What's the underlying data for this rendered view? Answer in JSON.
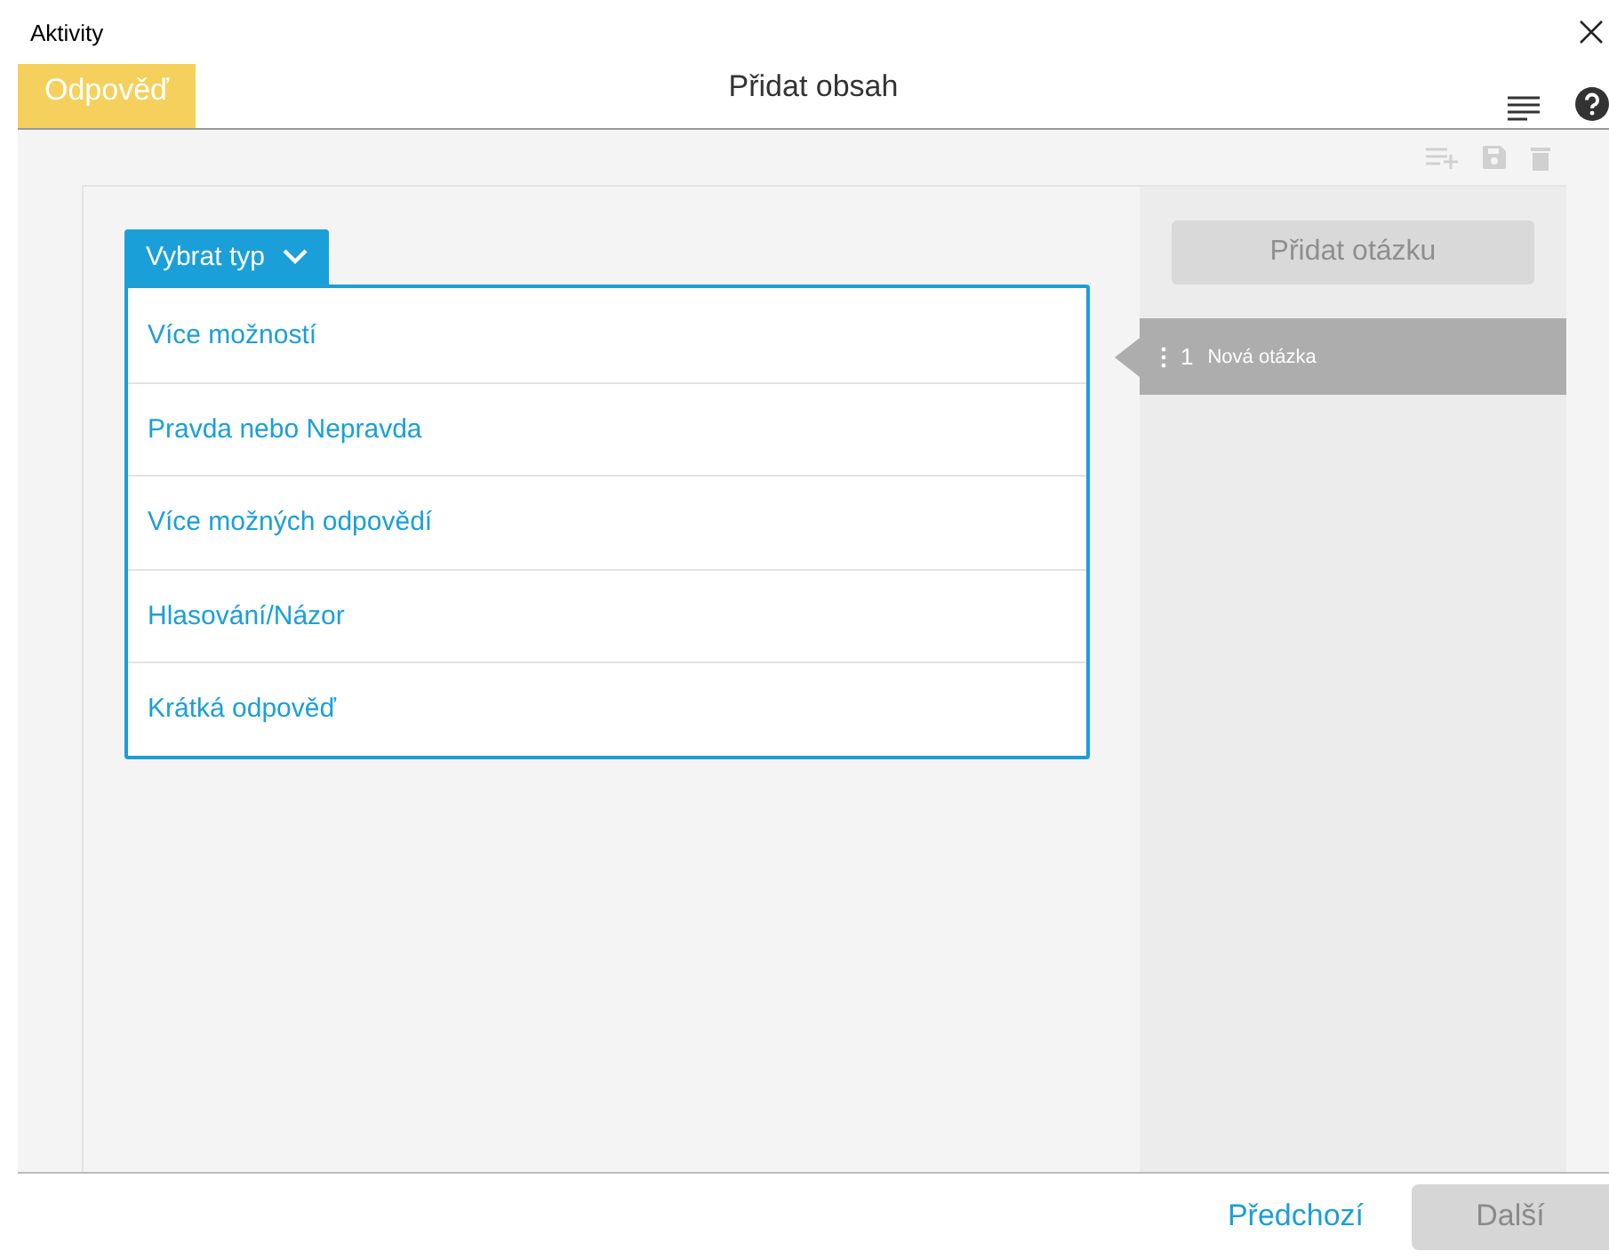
{
  "window": {
    "title": "Aktivity"
  },
  "header": {
    "tab": {
      "label": "Odpověď",
      "selected": true
    },
    "title": "Přidat obsah"
  },
  "type_menu": {
    "label": "Vybrat typ",
    "expanded": true,
    "options": [
      {
        "label": "Více možností"
      },
      {
        "label": "Pravda nebo Nepravda"
      },
      {
        "label": "Více možných odpovědí"
      },
      {
        "label": "Hlasování/Názor"
      },
      {
        "label": "Krátká odpověď"
      }
    ]
  },
  "sidebar": {
    "add_button": {
      "label": "Přidat otázku",
      "disabled": true
    },
    "questions": [
      {
        "number": "1",
        "title": "Nová otázka",
        "selected": true
      }
    ]
  },
  "footer": {
    "previous": {
      "label": "Předchozí",
      "disabled": false
    },
    "next": {
      "label": "Další",
      "disabled": true
    }
  }
}
